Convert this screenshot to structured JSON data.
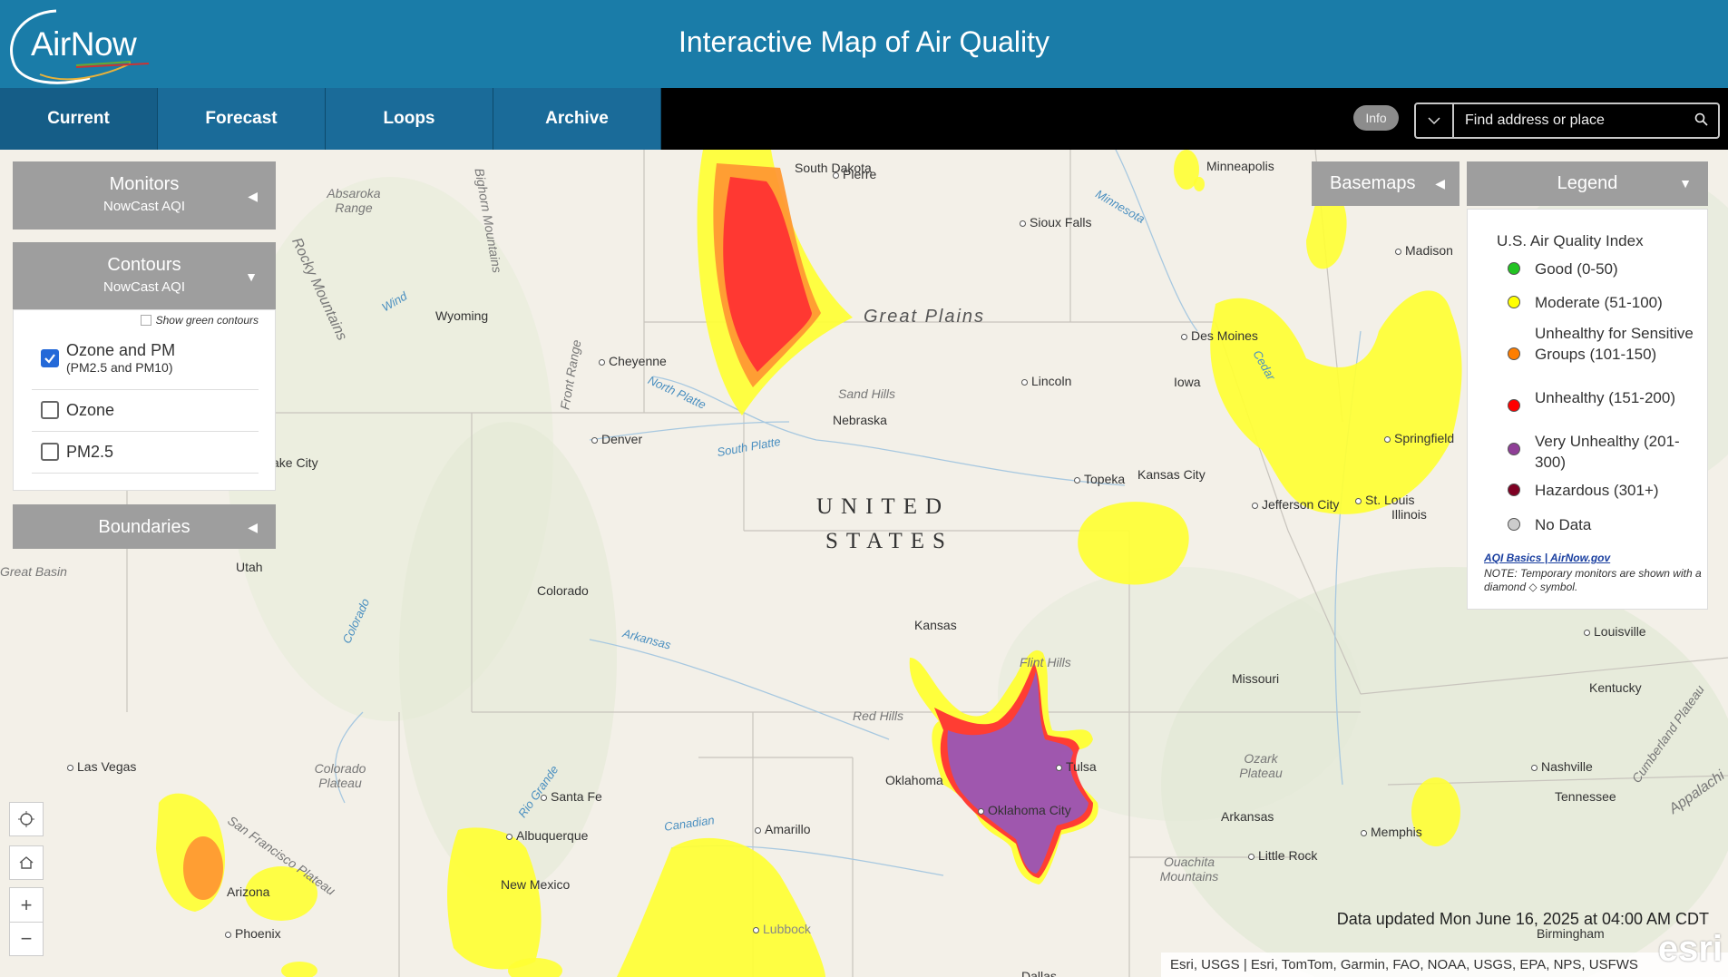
{
  "header": {
    "logo_text": "AirNow",
    "title": "Interactive Map of Air Quality"
  },
  "nav": {
    "tabs": [
      {
        "label": "Current",
        "active": true
      },
      {
        "label": "Forecast",
        "active": false
      },
      {
        "label": "Loops",
        "active": false
      },
      {
        "label": "Archive",
        "active": false
      }
    ],
    "info_label": "Info",
    "search_placeholder": "Find address or place"
  },
  "panels": {
    "monitors": {
      "title": "Monitors",
      "subtitle": "NowCast AQI"
    },
    "contours": {
      "title": "Contours",
      "subtitle": "NowCast AQI",
      "show_green": "Show green contours",
      "options": [
        {
          "label": "Ozone and PM",
          "sub": "(PM2.5 and PM10)",
          "checked": true
        },
        {
          "label": "Ozone",
          "sub": "",
          "checked": false
        },
        {
          "label": "PM2.5",
          "sub": "",
          "checked": false
        }
      ]
    },
    "boundaries": {
      "title": "Boundaries"
    },
    "basemaps": {
      "title": "Basemaps"
    },
    "legend": {
      "title": "Legend",
      "index_title": "U.S. Air Quality Index",
      "items": [
        {
          "label": "Good (0-50)",
          "color": "#22c322"
        },
        {
          "label": "Moderate (51-100)",
          "color": "#ffff00"
        },
        {
          "label": "Unhealthy for Sensitive Groups (101-150)",
          "color": "#ff7e00"
        },
        {
          "label": "Unhealthy (151-200)",
          "color": "#ff0000"
        },
        {
          "label": "Very Unhealthy (201-300)",
          "color": "#8f3f97"
        },
        {
          "label": "Hazardous (301+)",
          "color": "#7e0023"
        },
        {
          "label": "No Data",
          "color": "#cccccc"
        }
      ],
      "link": "AQI Basics | AirNow.gov",
      "note": "NOTE: Temporary monitors are shown with a diamond ◇ symbol."
    }
  },
  "map": {
    "country_line1": "UNITED",
    "country_line2": "STATES",
    "cities": [
      "Pierre",
      "Sioux Falls",
      "Minneapolis",
      "Madison",
      "Des Moines",
      "Cheyenne",
      "Lincoln",
      "Denver",
      "Topeka",
      "Kansas City",
      "Jefferson City",
      "St. Louis",
      "Springfield",
      "Louisville",
      "Nashville",
      "Memphis",
      "Little Rock",
      "Tulsa",
      "Oklahoma City",
      "Amarillo",
      "Albuquerque",
      "Santa Fe",
      "Las Vegas",
      "Phoenix",
      "Lubbock"
    ],
    "regions": [
      "South Dakota",
      "Great Plains",
      "Sand Hills",
      "Nebraska",
      "Wyoming",
      "Iowa",
      "Kansas",
      "Colorado",
      "Utah",
      "Missouri",
      "Kentucky",
      "Illinois",
      "Oklahoma",
      "Arkansas",
      "Tennessee",
      "New Mexico",
      "Arizona",
      "Red Hills",
      "Flint Hills",
      "Ozark Plateau",
      "Ouachita Mountains",
      "Colorado Plateau",
      "Great Basin",
      "Absaroka Range",
      "Bighorn Mountains",
      "Rocky Mountains",
      "Front Range",
      "San Francisco Plateau",
      "Cumberland Plateau",
      "Appalachi",
      "Birmingham",
      "Dallas",
      "ake City"
    ],
    "rivers": [
      "Minnesota",
      "North Platte",
      "South Platte",
      "Arkansas",
      "Canadian",
      "Colorado",
      "Rio Grande",
      "Wind",
      "Cedar"
    ],
    "updated": "Data updated Mon June 16, 2025 at 04:00 AM CDT",
    "attribution": "Esri, USGS | Esri, TomTom, Garmin, FAO, NOAA, USGS, EPA, NPS, USFWS",
    "esri_logo": "esri"
  }
}
